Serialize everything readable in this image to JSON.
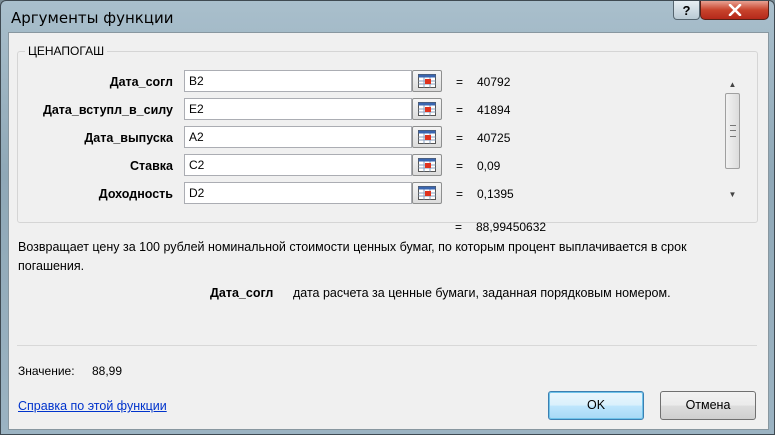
{
  "window": {
    "title": "Аргументы функции",
    "help_label": "?"
  },
  "function": {
    "name": "ЦЕНАПОГАШ",
    "arguments": [
      {
        "label": "Дата_согл",
        "value": "B2",
        "result": "40792"
      },
      {
        "label": "Дата_вступл_в_силу",
        "value": "E2",
        "result": "41894"
      },
      {
        "label": "Дата_выпуска",
        "value": "A2",
        "result": "40725"
      },
      {
        "label": "Ставка",
        "value": "C2",
        "result": "0,09"
      },
      {
        "label": "Доходность",
        "value": "D2",
        "result": "0,1395"
      }
    ],
    "equals_sign": "=",
    "formula_result": "88,99450632",
    "description": "Возвращает цену за 100 рублей номинальной стоимости ценных бумаг, по которым процент выплачивается в срок погашения.",
    "selected_arg_name": "Дата_согл",
    "selected_arg_description": "дата расчета за ценные бумаги, заданная порядковым номером."
  },
  "footer": {
    "value_label": "Значение:",
    "value": "88,99",
    "help_link": "Справка по этой функции",
    "ok_label": "OK",
    "cancel_label": "Отмена"
  },
  "colors": {
    "link": "#0033cc",
    "close_button": "#c8432c"
  }
}
